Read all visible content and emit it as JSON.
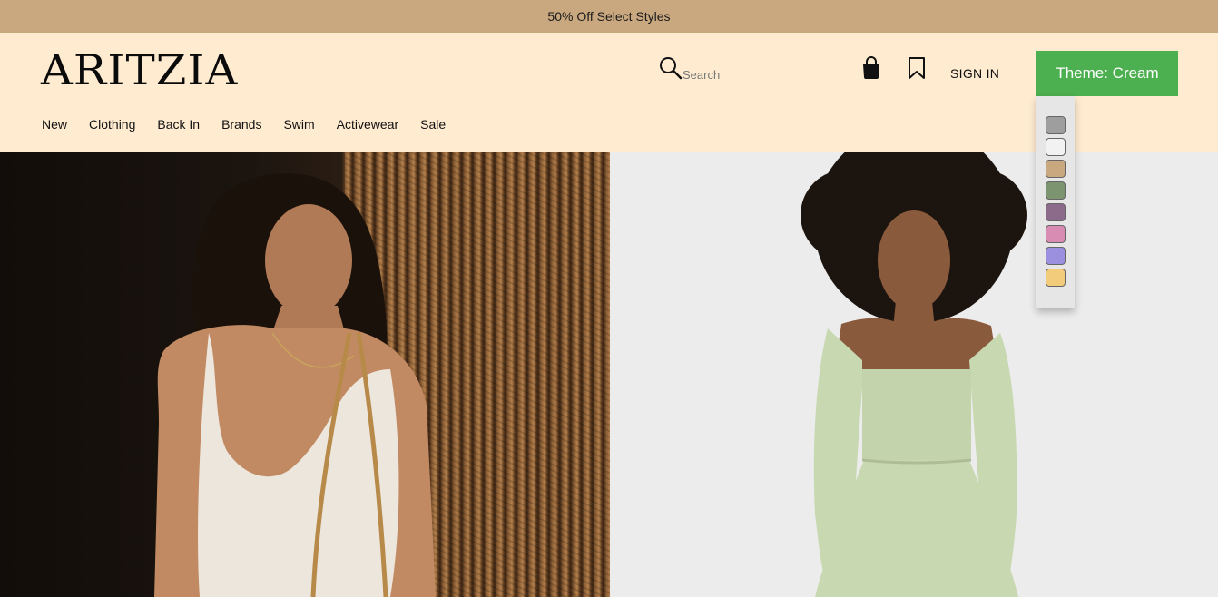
{
  "promo": {
    "text": "50% Off Select Styles"
  },
  "header": {
    "logo": "ARITZIA",
    "search_placeholder": "Search",
    "search_value": "",
    "sign_in_label": "SIGN IN",
    "theme_button_label": "Theme: Cream"
  },
  "nav": {
    "items": [
      {
        "label": "New"
      },
      {
        "label": "Clothing"
      },
      {
        "label": "Back In"
      },
      {
        "label": "Brands"
      },
      {
        "label": "Swim"
      },
      {
        "label": "Activewear"
      },
      {
        "label": "Sale"
      }
    ]
  },
  "theme_palette": {
    "swatches": [
      "#9e9e9e",
      "#f2f2f2",
      "#c9a87f",
      "#7d9470",
      "#8c6b8a",
      "#d98cb3",
      "#9b8fe0",
      "#f2cc7a"
    ]
  },
  "colors": {
    "promo_bg": "#c9a87f",
    "header_bg": "#feebd0",
    "theme_button_bg": "#4caf50",
    "dress_green": "#c8d9b2"
  },
  "hero": {
    "left_image": "model-in-white-knit-top",
    "right_image": "model-in-sage-green-dress"
  }
}
